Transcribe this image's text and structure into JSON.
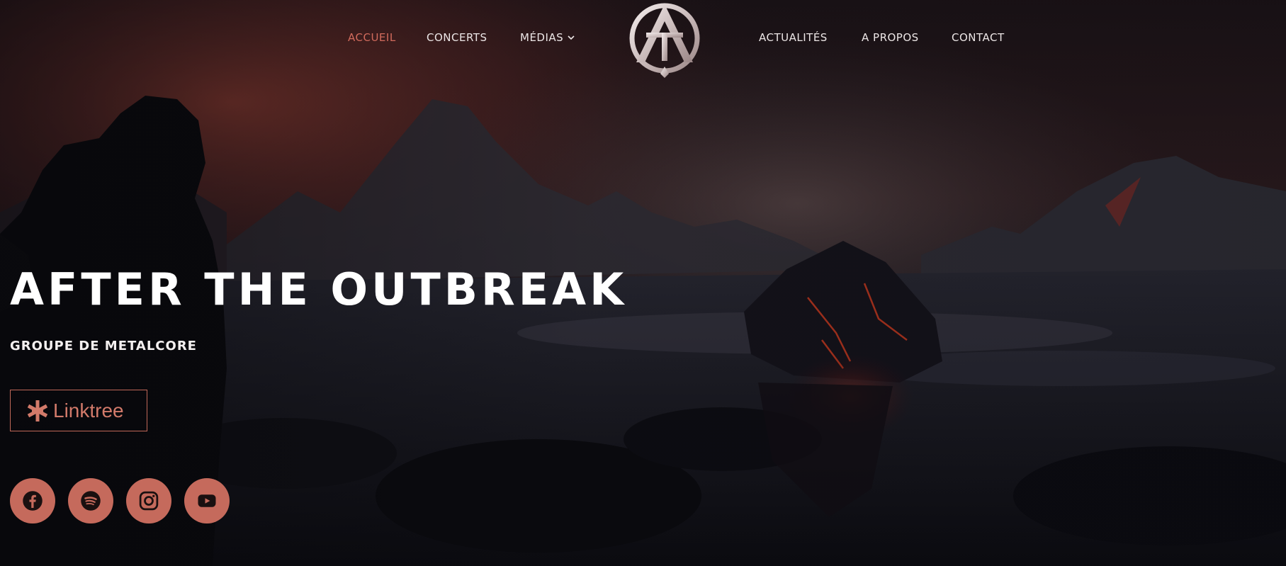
{
  "nav": {
    "left": [
      {
        "label": "ACCUEIL",
        "active": true
      },
      {
        "label": "CONCERTS"
      },
      {
        "label": "MÉDIAS",
        "dropdown": true
      }
    ],
    "right": [
      {
        "label": "ACTUALITÉS"
      },
      {
        "label": "A PROPOS"
      },
      {
        "label": "CONTACT"
      }
    ],
    "logo_icon": "band-logo-icon"
  },
  "hero": {
    "title": "AFTER THE OUTBREAK",
    "subtitle": "GROUPE DE METALCORE",
    "cta_label": "Linktree",
    "cta_icon": "linktree-asterisk-icon"
  },
  "socials": [
    {
      "icon": "facebook-icon"
    },
    {
      "icon": "spotify-icon"
    },
    {
      "icon": "instagram-icon"
    },
    {
      "icon": "youtube-icon"
    }
  ],
  "colors": {
    "accent": "#c56a5c",
    "nav_text": "#ece6e6",
    "nav_active": "#d06a5c",
    "background": "#0c0d12"
  }
}
